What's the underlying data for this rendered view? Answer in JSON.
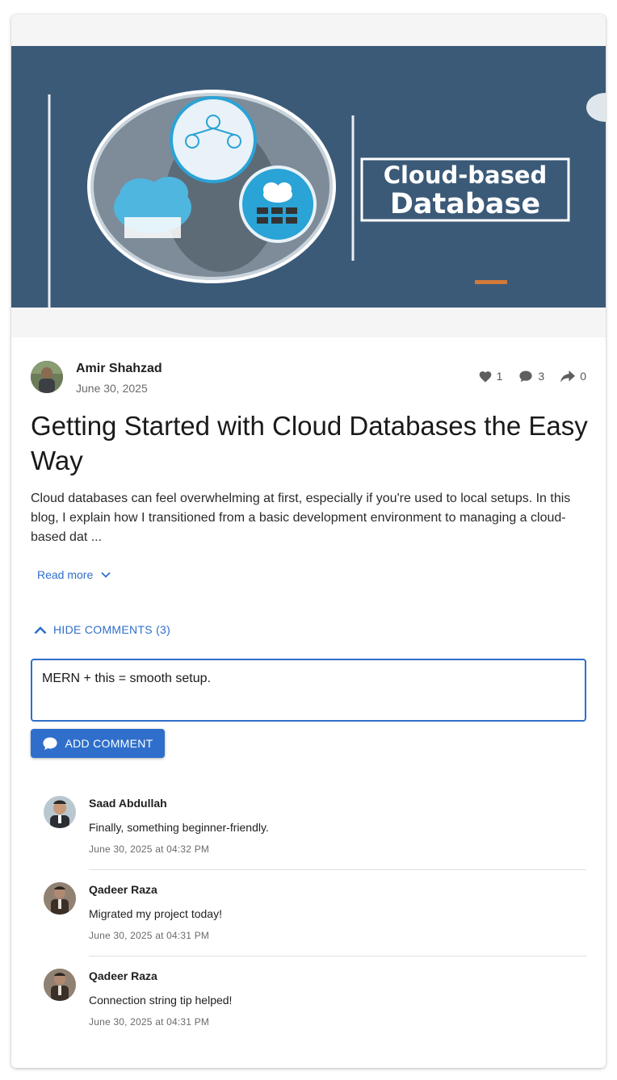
{
  "banner": {
    "headline_line1": "Cloud-based",
    "headline_line2": "Database"
  },
  "post": {
    "author": "Amir Shahzad",
    "date": "June 30, 2025",
    "stats": {
      "likes": "1",
      "comments": "3",
      "shares": "0"
    },
    "title": "Getting Started with Cloud Databases the Easy Way",
    "excerpt": "Cloud databases can feel overwhelming at first, especially if you're used to local setups. In this blog, I explain how I transitioned from a basic development environment to managing a cloud-based dat ...",
    "read_more_label": "Read more"
  },
  "comments_section": {
    "toggle_label": "HIDE COMMENTS (3)",
    "input_value": "MERN + this = smooth setup.",
    "add_button_label": "ADD COMMENT",
    "items": [
      {
        "name": "Saad Abdullah",
        "text": "Finally, something beginner-friendly.",
        "time": "June 30, 2025 at 04:32 PM"
      },
      {
        "name": "Qadeer Raza",
        "text": "Migrated my project today!",
        "time": "June 30, 2025 at 04:31 PM"
      },
      {
        "name": "Qadeer Raza",
        "text": "Connection string tip helped!",
        "time": "June 30, 2025 at 04:31 PM"
      }
    ]
  },
  "colors": {
    "accent": "#2f6fcb",
    "banner_bg": "#3b5a78"
  },
  "icons": {
    "likes": "heart-icon",
    "comments": "comment-bubble-icon",
    "shares": "share-arrow-icon",
    "read_more": "chevron-down-icon",
    "toggle": "chevron-up-icon",
    "add_comment": "comment-bubble-icon"
  }
}
